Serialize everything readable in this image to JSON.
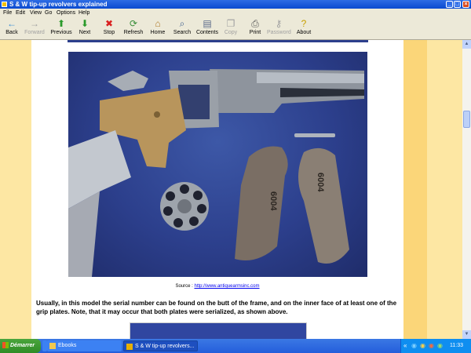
{
  "window": {
    "title": "S & W tip-up revolvers explained",
    "controls": {
      "minimize": "_",
      "maximize": "□",
      "close": "×"
    }
  },
  "menu": [
    "File",
    "Edit",
    "View",
    "Go",
    "Options",
    "Help"
  ],
  "toolbar": {
    "back": "Back",
    "forward": "Forward",
    "previous": "Previous",
    "next": "Next",
    "stop": "Stop",
    "refresh": "Refresh",
    "home": "Home",
    "search": "Search",
    "contents": "Contents",
    "copy": "Copy",
    "print": "Print",
    "password": "Password",
    "about": "About"
  },
  "icons": {
    "back": "←",
    "forward": "→",
    "previous": "⬆",
    "next": "⬇",
    "stop": "✖",
    "refresh": "⟳",
    "home": "⌂",
    "search": "⌕",
    "contents": "▤",
    "copy": "❐",
    "print": "⎙",
    "password": "⚷",
    "about": "?"
  },
  "content": {
    "photo_alt": "Smith & Wesson tip-up revolver with cylinder, screw and grip plates",
    "caption_prefix": "Source : ",
    "caption_link": "http://www.antiquearmsinc.com",
    "paragraph": "Usually, in this model the serial number can be found on the butt of the frame, and on the inner face of at least one of the grip plates. Note, that it may occur that both plates were serialized, as shown above.",
    "grip_serial_left": "6004",
    "grip_serial_right": "6004"
  },
  "scrollbar": {
    "up": "▲",
    "down": "▼"
  },
  "taskbar": {
    "start": "Démarrer",
    "tasks": [
      {
        "label": "",
        "active": false
      },
      {
        "label": "Ebooks",
        "active": false
      },
      {
        "label": "S & W tip-up revolvers...",
        "active": true
      }
    ],
    "clock": "11:33"
  },
  "colors": {
    "title_bar": "#0a4ad0",
    "page_border": "#fbd679",
    "page_border_light": "#fde7a3",
    "photo_background": "#2c3f8c",
    "link": "#0000ee",
    "taskbar": "#245edb"
  }
}
